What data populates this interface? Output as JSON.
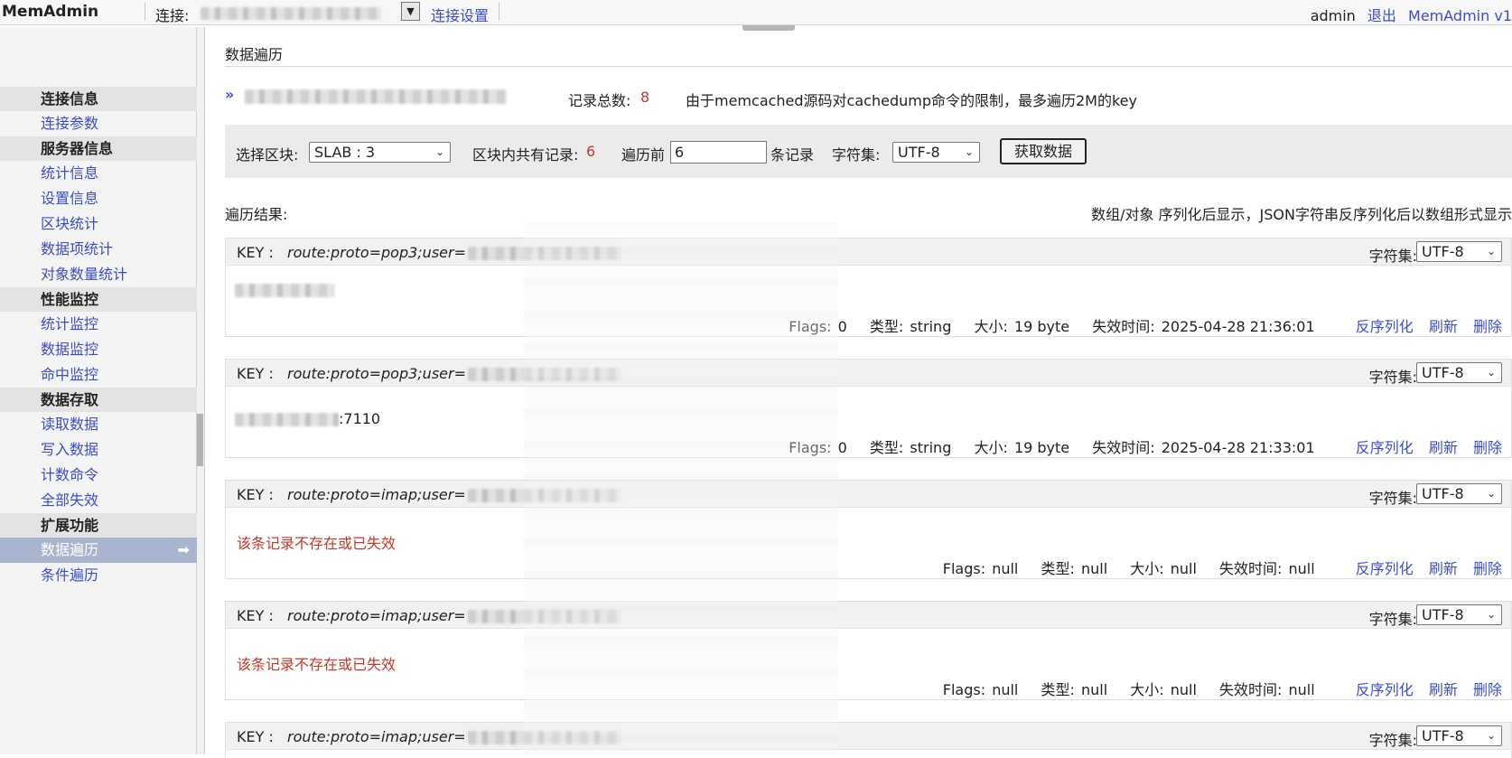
{
  "topbar": {
    "logo": "MemAdmin",
    "connection_label": "连接:",
    "connection_settings": "连接设置",
    "user": "admin",
    "logout": "退出",
    "version": "MemAdmin v1"
  },
  "sidebar": {
    "groups": [
      {
        "title": "连接信息",
        "items": [
          "连接参数"
        ]
      },
      {
        "title": "服务器信息",
        "items": [
          "统计信息",
          "设置信息",
          "区块统计",
          "数据项统计",
          "对象数量统计"
        ]
      },
      {
        "title": "性能监控",
        "items": [
          "统计监控",
          "数据监控",
          "命中监控"
        ]
      },
      {
        "title": "数据存取",
        "items": [
          "读取数据",
          "写入数据",
          "计数命令",
          "全部失效"
        ]
      },
      {
        "title": "扩展功能",
        "items": [
          "数据遍历",
          "条件遍历"
        ]
      }
    ],
    "active_item": "数据遍历",
    "active_arrow": "➡"
  },
  "main": {
    "title": "数据遍历",
    "total_label": "记录总数:",
    "total_value": "8",
    "note": "由于memcached源码对cachedump命令的限制，最多遍历2M的key",
    "filter": {
      "slab_label": "选择区块:",
      "slab_value": "SLAB : 3",
      "in_slab_label": "区块内共有记录:",
      "in_slab_value": "6",
      "traverse_prefix": "遍历前",
      "traverse_value": "6",
      "traverse_suffix": "条记录",
      "charset_label": "字符集:",
      "charset_value": "UTF-8",
      "fetch_button": "获取数据"
    },
    "result_label": "遍历结果:",
    "result_hint": "数组/对象 序列化后显示，JSON字符串反序列化后以数组形式显示"
  },
  "records": [
    {
      "key_label": "KEY :",
      "key": "route:proto=pop3;user=",
      "charset_label": "字符集:",
      "charset": "UTF-8",
      "value": "",
      "value_error": "",
      "flags_label": "Flags:",
      "flags": "0",
      "type_label": "类型:",
      "type": "string",
      "size_label": "大小:",
      "size": "19 byte",
      "expire_label": "失效时间:",
      "expire": "2025-04-28 21:36:01",
      "unserialize": "反序列化",
      "refresh": "刷新",
      "delete": "删除"
    },
    {
      "key_label": "KEY :",
      "key": "route:proto=pop3;user=",
      "charset_label": "字符集:",
      "charset": "UTF-8",
      "value": ":7110",
      "value_error": "",
      "flags_label": "Flags:",
      "flags": "0",
      "type_label": "类型:",
      "type": "string",
      "size_label": "大小:",
      "size": "19 byte",
      "expire_label": "失效时间:",
      "expire": "2025-04-28 21:33:01",
      "unserialize": "反序列化",
      "refresh": "刷新",
      "delete": "删除"
    },
    {
      "key_label": "KEY :",
      "key": "route:proto=imap;user=",
      "charset_label": "字符集:",
      "charset": "UTF-8",
      "value": "",
      "value_error": "该条记录不存在或已失效",
      "flags_label": "Flags:",
      "flags": "null",
      "type_label": "类型:",
      "type": "null",
      "size_label": "大小:",
      "size": "null",
      "expire_label": "失效时间:",
      "expire": "null",
      "unserialize": "反序列化",
      "refresh": "刷新",
      "delete": "删除"
    },
    {
      "key_label": "KEY :",
      "key": "route:proto=imap;user=",
      "charset_label": "字符集:",
      "charset": "UTF-8",
      "value": "",
      "value_error": "该条记录不存在或已失效",
      "flags_label": "Flags:",
      "flags": "null",
      "type_label": "类型:",
      "type": "null",
      "size_label": "大小:",
      "size": "null",
      "expire_label": "失效时间:",
      "expire": "null",
      "unserialize": "反序列化",
      "refresh": "刷新",
      "delete": "删除"
    },
    {
      "key_label": "KEY :",
      "key": "route:proto=imap;user=",
      "charset_label": "字符集:",
      "charset": "UTF-8"
    }
  ],
  "icons": {
    "dropdown": "▼",
    "select_chevron": "⌄",
    "breadcrumb_chevron": "»"
  }
}
